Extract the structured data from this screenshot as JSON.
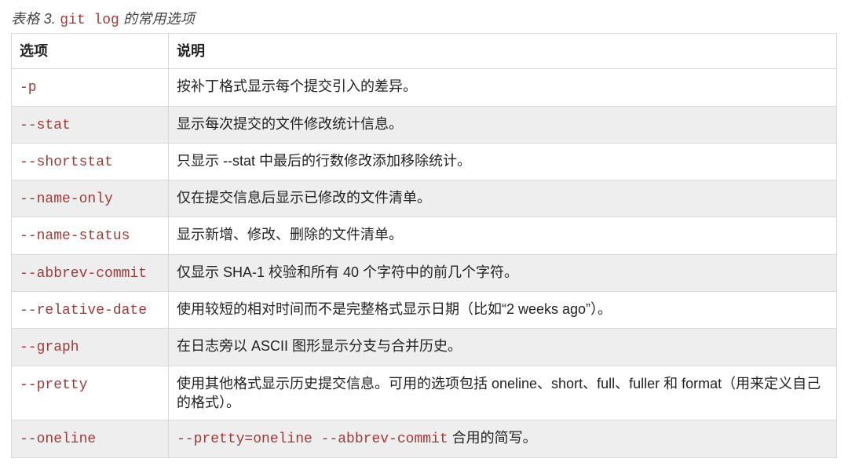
{
  "caption": {
    "prefix": "表格 3. ",
    "code": "git log",
    "suffix": " 的常用选项"
  },
  "table": {
    "headers": [
      "选项",
      "说明"
    ],
    "rows": [
      {
        "option": "-p",
        "desc": [
          {
            "t": "text",
            "v": "按补丁格式显示每个提交引入的差异。"
          }
        ]
      },
      {
        "option": "--stat",
        "desc": [
          {
            "t": "text",
            "v": "显示每次提交的文件修改统计信息。"
          }
        ]
      },
      {
        "option": "--shortstat",
        "desc": [
          {
            "t": "text",
            "v": "只显示 --stat 中最后的行数修改添加移除统计。"
          }
        ]
      },
      {
        "option": "--name-only",
        "desc": [
          {
            "t": "text",
            "v": "仅在提交信息后显示已修改的文件清单。"
          }
        ]
      },
      {
        "option": "--name-status",
        "desc": [
          {
            "t": "text",
            "v": "显示新增、修改、删除的文件清单。"
          }
        ]
      },
      {
        "option": "--abbrev-commit",
        "desc": [
          {
            "t": "text",
            "v": "仅显示 SHA-1 校验和所有 40 个字符中的前几个字符。"
          }
        ]
      },
      {
        "option": "--relative-date",
        "desc": [
          {
            "t": "text",
            "v": "使用较短的相对时间而不是完整格式显示日期（比如“2 weeks ago”）。"
          }
        ]
      },
      {
        "option": "--graph",
        "desc": [
          {
            "t": "text",
            "v": "在日志旁以 ASCII 图形显示分支与合并历史。"
          }
        ]
      },
      {
        "option": "--pretty",
        "desc": [
          {
            "t": "text",
            "v": "使用其他格式显示历史提交信息。可用的选项包括 oneline、short、full、fuller 和 format（用来定义自己的格式）。"
          }
        ]
      },
      {
        "option": "--oneline",
        "desc": [
          {
            "t": "code",
            "v": "--pretty=oneline --abbrev-commit"
          },
          {
            "t": "text",
            "v": " 合用的简写。"
          }
        ]
      }
    ]
  }
}
